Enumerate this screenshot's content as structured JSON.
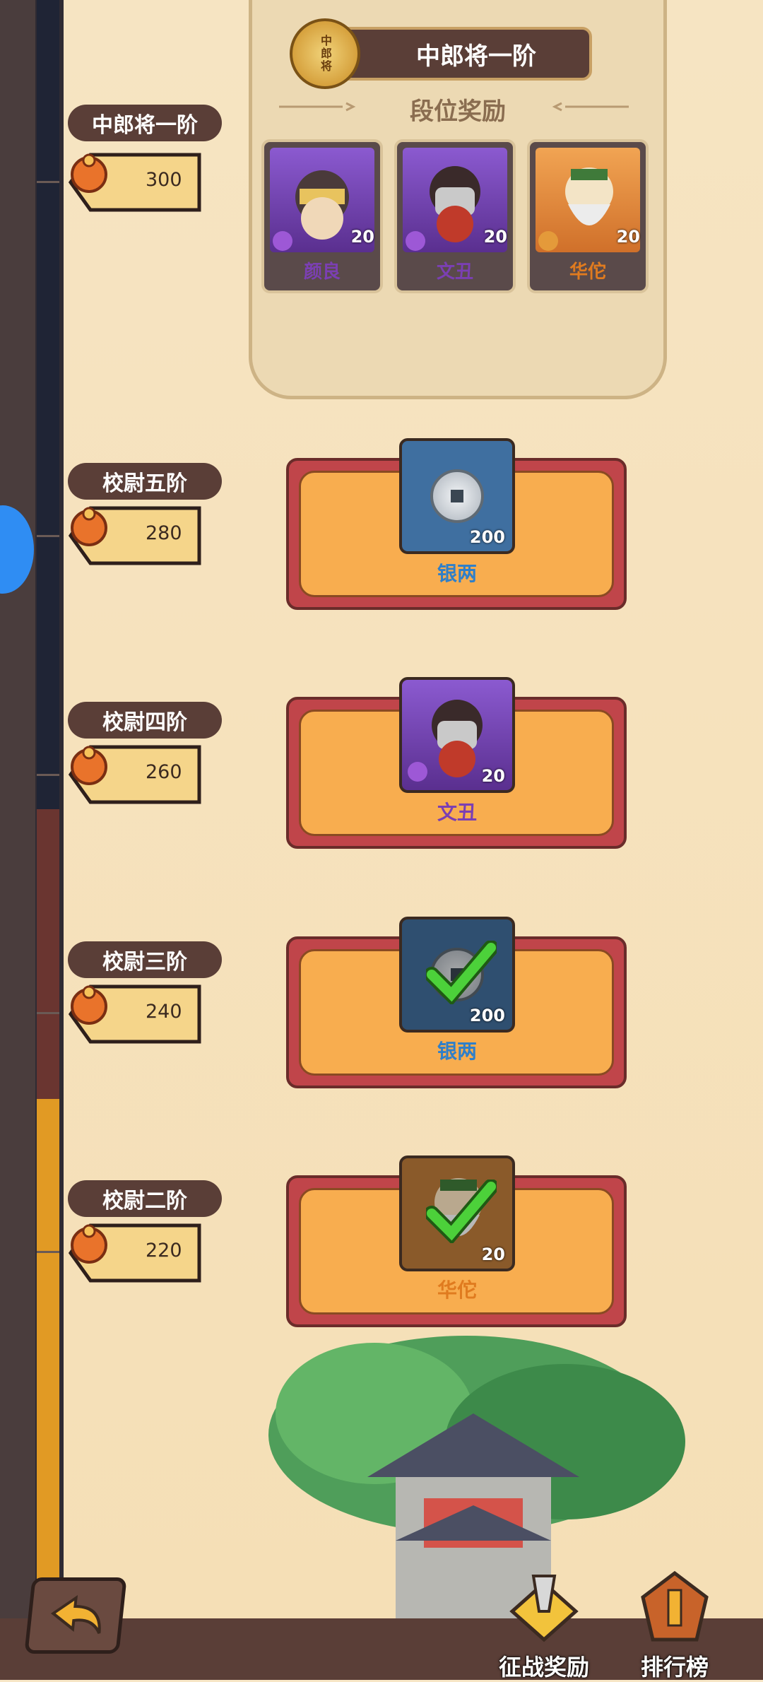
{
  "top_panel": {
    "rank_title": "中郎将一阶",
    "medal_text": "中郎将",
    "section_heading": "段位奖励",
    "heroes": [
      {
        "name": "颜良",
        "count": "20",
        "name_color": "#7b3fb3"
      },
      {
        "name": "文丑",
        "count": "20",
        "name_color": "#7b3fb3"
      },
      {
        "name": "华佗",
        "count": "20",
        "name_color": "#e07b1f"
      }
    ]
  },
  "tiers": [
    {
      "label": "中郎将一阶",
      "cost": "300"
    },
    {
      "label": "校尉五阶",
      "cost": "280",
      "reward": {
        "name": "银两",
        "count": "200",
        "icon": "silver-coin-icon",
        "claimed": false,
        "name_color": "#2f7fc9"
      }
    },
    {
      "label": "校尉四阶",
      "cost": "260",
      "reward": {
        "name": "文丑",
        "count": "20",
        "icon": "hero-portrait",
        "claimed": false,
        "name_color": "#7b3fb3"
      }
    },
    {
      "label": "校尉三阶",
      "cost": "240",
      "reward": {
        "name": "银两",
        "count": "200",
        "icon": "silver-coin-icon",
        "claimed": true,
        "name_color": "#2f7fc9"
      }
    },
    {
      "label": "校尉二阶",
      "cost": "220",
      "reward": {
        "name": "华佗",
        "count": "20",
        "icon": "hero-portrait",
        "claimed": true,
        "name_color": "#e07b1f"
      }
    }
  ],
  "bottom_nav": {
    "back_icon": "back-arrow-icon",
    "campaign_rewards": "征战奖励",
    "leaderboard": "排行榜"
  },
  "colors": {
    "progress_gold": "#e19a24",
    "panel_red": "#c0454a",
    "panel_orange": "#f8ad4f",
    "label_brown": "#5a3e37"
  }
}
